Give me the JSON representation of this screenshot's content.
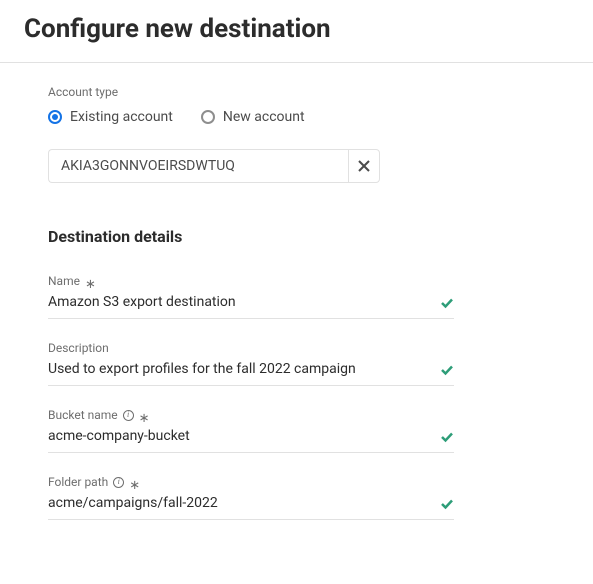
{
  "header": {
    "title": "Configure new destination"
  },
  "accountType": {
    "label": "Account type",
    "existing": "Existing account",
    "new": "New account",
    "selected_value": "AKIA3GONNVOEIRSDWTUQ"
  },
  "details": {
    "heading": "Destination details",
    "name": {
      "label": "Name",
      "value": "Amazon S3 export destination"
    },
    "description": {
      "label": "Description",
      "value": "Used to export profiles for the fall 2022 campaign"
    },
    "bucket": {
      "label": "Bucket name",
      "value": "acme-company-bucket"
    },
    "folder": {
      "label": "Folder path",
      "value": "acme/campaigns/fall-2022"
    }
  }
}
